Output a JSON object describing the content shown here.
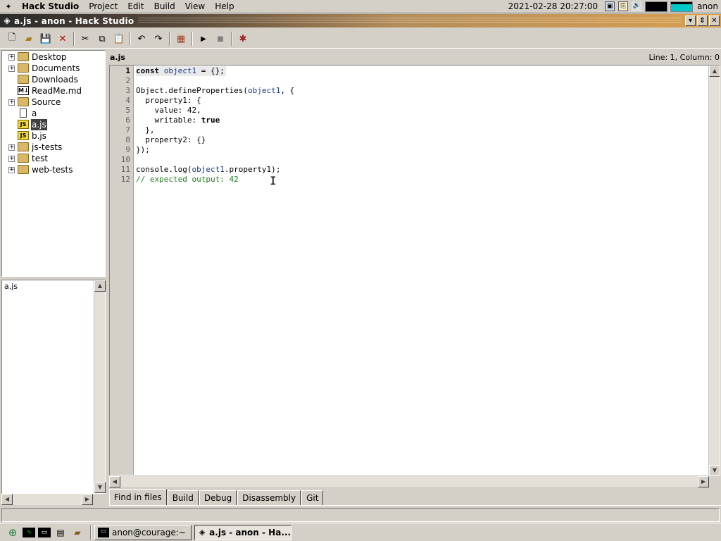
{
  "menubar": {
    "app_name": "Hack Studio",
    "items": [
      "Project",
      "Edit",
      "Build",
      "View",
      "Help"
    ],
    "clock": "2021-02-28 20:27:00",
    "user": "anon",
    "memory_fill": 0.75,
    "colors": {
      "memory": "#00c8c8"
    }
  },
  "window": {
    "title": "a.js - anon - Hack Studio"
  },
  "toolbar": {
    "buttons": [
      "new-file",
      "open-folder",
      "save",
      "delete",
      "cut",
      "copy",
      "paste",
      "undo",
      "redo",
      "build",
      "run",
      "stop",
      "debug"
    ]
  },
  "tree": {
    "items": [
      {
        "label": "Desktop",
        "type": "folder",
        "expandable": true
      },
      {
        "label": "Documents",
        "type": "folder",
        "expandable": true
      },
      {
        "label": "Downloads",
        "type": "folder",
        "expandable": false
      },
      {
        "label": "ReadMe.md",
        "type": "markdown",
        "expandable": false
      },
      {
        "label": "Source",
        "type": "folder",
        "expandable": true
      },
      {
        "label": "a",
        "type": "file",
        "expandable": false
      },
      {
        "label": "a.js",
        "type": "js",
        "expandable": false,
        "selected": true
      },
      {
        "label": "b.js",
        "type": "js",
        "expandable": false
      },
      {
        "label": "js-tests",
        "type": "folder",
        "expandable": true
      },
      {
        "label": "test",
        "type": "folder",
        "expandable": true
      },
      {
        "label": "web-tests",
        "type": "folder",
        "expandable": true
      }
    ]
  },
  "open_files": {
    "items": [
      "a.js"
    ]
  },
  "editor": {
    "filename": "a.js",
    "position": "Line: 1, Column: 0",
    "line_numbers": [
      "1",
      "2",
      "3",
      "4",
      "5",
      "6",
      "7",
      "8",
      "9",
      "10",
      "11",
      "12"
    ],
    "lines": [
      "const object1 = {};",
      "",
      "Object.defineProperties(object1, {",
      "  property1: {",
      "    value: 42,",
      "    writable: true",
      "  },",
      "  property2: {}",
      "});",
      "",
      "console.log(object1.property1);",
      "// expected output: 42"
    ]
  },
  "tabs": {
    "items": [
      "Find in files",
      "Build",
      "Debug",
      "Disassembly",
      "Git"
    ],
    "active": 0
  },
  "statusbar": {
    "text": ""
  },
  "taskbar": {
    "buttons": [
      {
        "label": "anon@courage:~",
        "icon": "terminal-icon"
      },
      {
        "label": "a.js - anon - Ha...",
        "icon": "hack-studio-icon",
        "active": true
      }
    ]
  }
}
